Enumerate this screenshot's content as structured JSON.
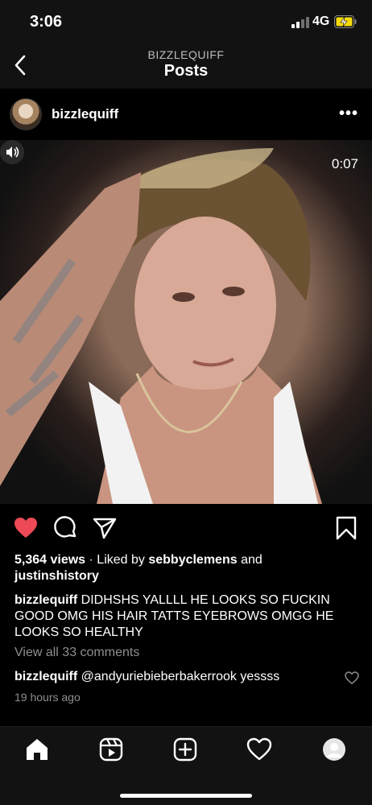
{
  "status": {
    "time": "3:06",
    "network": "4G"
  },
  "header": {
    "subtitle": "BIZZLEQUIFF",
    "title": "Posts"
  },
  "post": {
    "username": "bizzlequiff",
    "more_label": "•••",
    "video_time": "0:07",
    "views": "5,364 views",
    "separator": " · ",
    "liked_by_prefix": "Liked by ",
    "liked_by_user1": "sebbyclemens",
    "liked_by_and": " and",
    "liked_by_user2": "justinshistory",
    "caption_user": "bizzlequiff",
    "caption_text": " DIDHSHS YALLLL HE LOOKS SO FUCKIN GOOD OMG HIS HAIR TATTS EYEBROWS OMGG HE LOOKS SO HEALTHY",
    "view_comments": "View all 33 comments",
    "comment_user": "bizzlequiff",
    "comment_text": " @andyuriebieberbakerrook yessss",
    "time_ago": "19 hours ago"
  },
  "colors": {
    "like": "#ed4956",
    "muted": "#8e8e8e",
    "bar": "#121212"
  },
  "icons": {
    "back": "chevron-left-icon",
    "more": "more-horizontal-icon",
    "like": "heart-filled-icon",
    "comment": "comment-bubble-icon",
    "share": "paper-plane-icon",
    "save": "bookmark-icon",
    "tag": "user-tag-icon",
    "sound": "speaker-icon",
    "tabs": [
      "home-icon",
      "reels-icon",
      "create-icon",
      "activity-heart-icon",
      "profile-avatar-icon"
    ]
  }
}
